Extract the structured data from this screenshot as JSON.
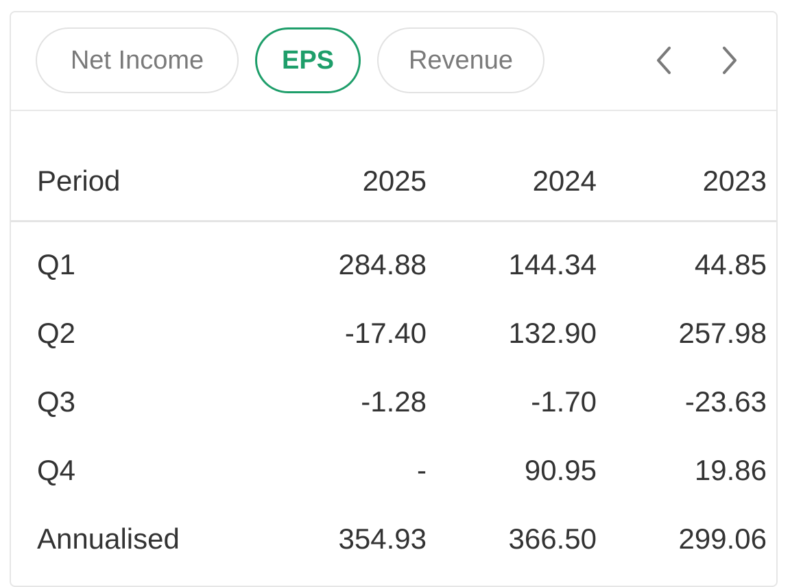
{
  "tabs": [
    {
      "label": "Net Income",
      "active": false
    },
    {
      "label": "EPS",
      "active": true
    },
    {
      "label": "Revenue",
      "active": false
    }
  ],
  "nav": {
    "prev_icon": "chevron-left-icon",
    "next_icon": "chevron-right-icon"
  },
  "colors": {
    "accent": "#1e9e6a",
    "border": "#e2e2e2",
    "text": "#333333",
    "tab_text": "#7a7a7a"
  },
  "table": {
    "columns": [
      "Period",
      "2025",
      "2024",
      "2023"
    ],
    "rows": [
      [
        "Q1",
        "284.88",
        "144.34",
        "44.85"
      ],
      [
        "Q2",
        "-17.40",
        "132.90",
        "257.98"
      ],
      [
        "Q3",
        "-1.28",
        "-1.70",
        "-23.63"
      ],
      [
        "Q4",
        "-",
        "90.95",
        "19.86"
      ],
      [
        "Annualised",
        "354.93",
        "366.50",
        "299.06"
      ]
    ]
  }
}
